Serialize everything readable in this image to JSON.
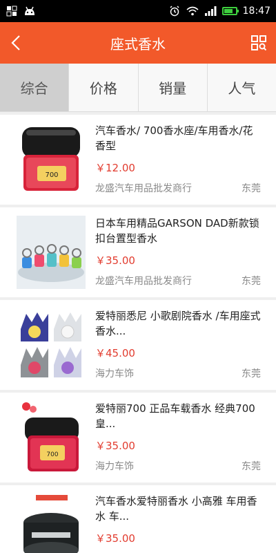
{
  "status": {
    "time": "18:47",
    "battery_level": 0.8
  },
  "header": {
    "title": "座式香水"
  },
  "tabs": [
    {
      "label": "综合",
      "active": true
    },
    {
      "label": "价格",
      "active": false
    },
    {
      "label": "销量",
      "active": false
    },
    {
      "label": "人气",
      "active": false
    }
  ],
  "products": [
    {
      "name": "汽车香水/ 700香水座/车用香水/花香型",
      "price": "￥12.00",
      "shop": "龙盛汽车用品批发商行",
      "city": "东莞"
    },
    {
      "name": "日本车用精品GARSON DAD新款锁扣台置型香水",
      "price": "￥35.00",
      "shop": "龙盛汽车用品批发商行",
      "city": "东莞"
    },
    {
      "name": "爱特丽悉尼 小歌剧院香水 /车用座式香水...",
      "price": "￥45.00",
      "shop": "海力车饰",
      "city": "东莞"
    },
    {
      "name": "爱特丽700 正品车载香水 经典700皇...",
      "price": "￥35.00",
      "shop": "海力车饰",
      "city": "东莞"
    },
    {
      "name": "汽车香水爱特丽香水 小高雅 车用香水 车...",
      "price": "￥35.00",
      "shop": "",
      "city": ""
    }
  ],
  "colors": {
    "accent": "#f2592a",
    "price": "#e23c2f"
  },
  "icons": {
    "back": "chevron-left-icon",
    "qr": "qr-scan-icon"
  }
}
